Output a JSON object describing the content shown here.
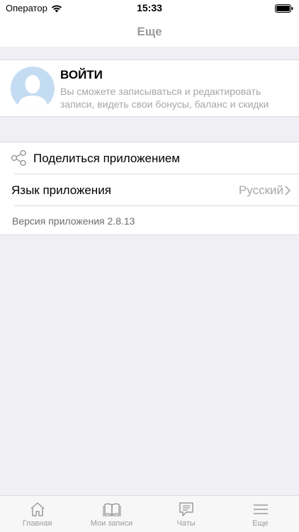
{
  "status_bar": {
    "carrier": "Оператор",
    "time": "15:33"
  },
  "nav": {
    "title": "Еще"
  },
  "login": {
    "title": "ВОЙТИ",
    "subtitle": "Вы сможете записываться и редактировать записи, видеть свои бонусы, баланс и скидки"
  },
  "menu": {
    "share_label": "Поделиться приложением",
    "language_label": "Язык приложения",
    "language_value": "Русский",
    "version": "Версия приложения 2.8.13"
  },
  "tabs": [
    {
      "label": "Главная",
      "icon": "home-icon"
    },
    {
      "label": "Мои записи",
      "icon": "book-icon"
    },
    {
      "label": "Чаты",
      "icon": "chat-icon"
    },
    {
      "label": "Еще",
      "icon": "menu-icon"
    }
  ],
  "colors": {
    "accent_gray": "#9b9b9b",
    "avatar": "#c4dcf2",
    "background": "#efeff4"
  }
}
